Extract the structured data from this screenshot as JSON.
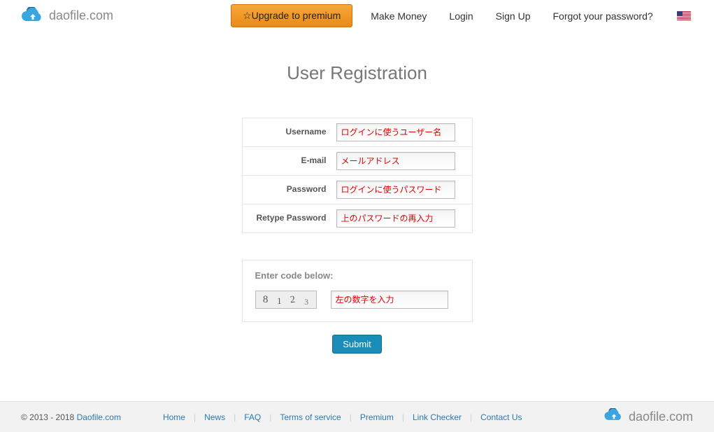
{
  "brand": {
    "name": "daofile.com"
  },
  "nav": {
    "upgrade": "Upgrade to premium",
    "make_money": "Make Money",
    "login": "Login",
    "signup": "Sign Up",
    "forgot": "Forgot your password?"
  },
  "page": {
    "title": "User Registration"
  },
  "form": {
    "username_label": "Username",
    "username_placeholder": "ログインに使うユーザー名",
    "email_label": "E-mail",
    "email_placeholder": "メールアドレス",
    "password_label": "Password",
    "password_placeholder": "ログインに使うパスワード",
    "retype_label": "Retype Password",
    "retype_placeholder": "上のパスワードの再入力"
  },
  "captcha": {
    "title": "Enter code below:",
    "digits": [
      "8",
      "1",
      "2",
      "3"
    ],
    "placeholder": "左の数字を入力"
  },
  "actions": {
    "submit": "Submit"
  },
  "footer": {
    "copyright_prefix": "© 2013 - 2018 ",
    "site_link": "Daofile.com",
    "links": {
      "home": "Home",
      "news": "News",
      "faq": "FAQ",
      "tos": "Terms of service",
      "premium": "Premium",
      "link_checker": "Link Checker",
      "contact": "Contact Us"
    }
  }
}
